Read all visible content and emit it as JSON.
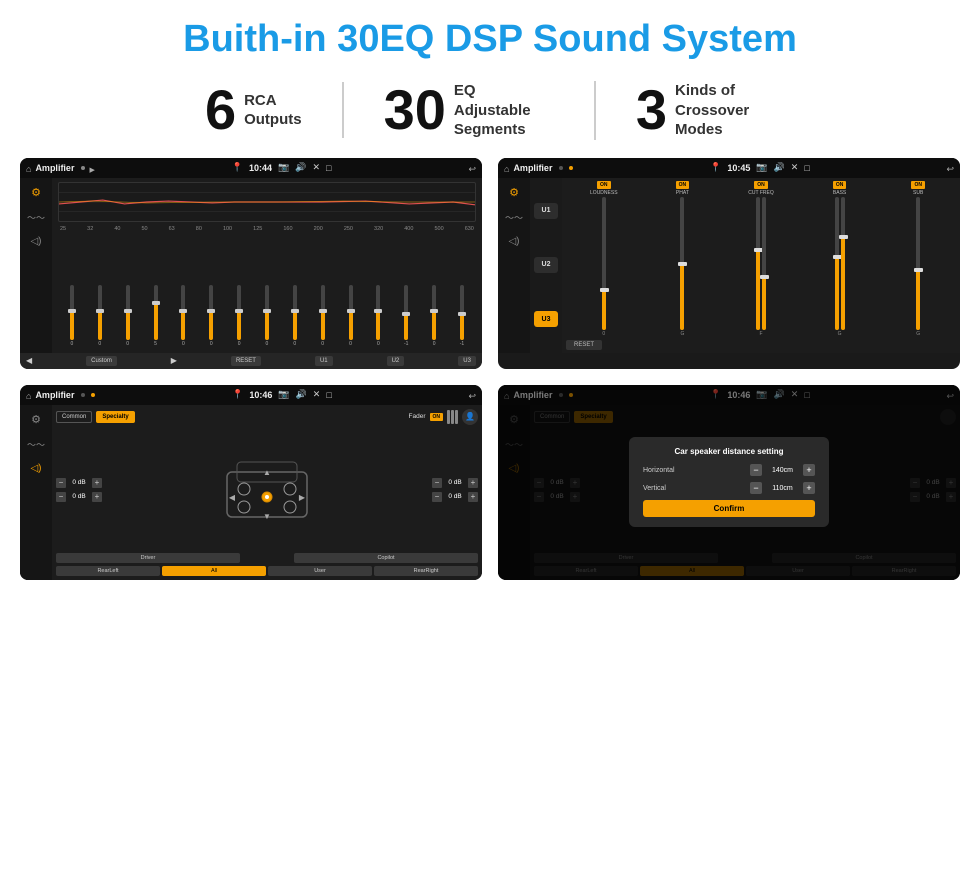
{
  "page": {
    "title": "Buith-in 30EQ DSP Sound System"
  },
  "stats": [
    {
      "number": "6",
      "label": "RCA\nOutputs"
    },
    {
      "number": "30",
      "label": "EQ Adjustable\nSegments"
    },
    {
      "number": "3",
      "label": "Kinds of\nCrossover Modes"
    }
  ],
  "screens": [
    {
      "id": "screen1",
      "app": "Amplifier",
      "time": "10:44",
      "type": "eq"
    },
    {
      "id": "screen2",
      "app": "Amplifier",
      "time": "10:45",
      "type": "amp-channels"
    },
    {
      "id": "screen3",
      "app": "Amplifier",
      "time": "10:46",
      "type": "fader"
    },
    {
      "id": "screen4",
      "app": "Amplifier",
      "time": "10:46",
      "type": "speaker-distance"
    }
  ],
  "eq": {
    "freqs": [
      "25",
      "32",
      "40",
      "50",
      "63",
      "80",
      "100",
      "125",
      "160",
      "200",
      "250",
      "320",
      "400",
      "500",
      "630"
    ],
    "values": [
      "0",
      "0",
      "0",
      "5",
      "0",
      "0",
      "0",
      "0",
      "0",
      "0",
      "0",
      "0",
      "-1",
      "0",
      "-1"
    ],
    "buttons": [
      "Custom",
      "RESET",
      "U1",
      "U2",
      "U3"
    ]
  },
  "ampChannels": {
    "presets": [
      "U1",
      "U2",
      "U3"
    ],
    "channels": [
      {
        "on": true,
        "name": "LOUDNESS"
      },
      {
        "on": true,
        "name": "PHAT"
      },
      {
        "on": true,
        "name": "CUT FREQ"
      },
      {
        "on": true,
        "name": "BASS"
      },
      {
        "on": true,
        "name": "SUB"
      }
    ],
    "resetLabel": "RESET"
  },
  "fader": {
    "tabs": [
      "Common",
      "Specialty"
    ],
    "activeTab": 1,
    "faderLabel": "Fader",
    "faderOn": "ON",
    "volumes": [
      "0 dB",
      "0 dB",
      "0 dB",
      "0 dB"
    ],
    "presets": [
      "Driver",
      "All",
      "User",
      "Copilot",
      "RearLeft",
      "RearRight"
    ]
  },
  "speakerDistance": {
    "title": "Car speaker distance setting",
    "horizontal": {
      "label": "Horizontal",
      "value": "140cm"
    },
    "vertical": {
      "label": "Vertical",
      "value": "110cm"
    },
    "confirmLabel": "Confirm"
  }
}
